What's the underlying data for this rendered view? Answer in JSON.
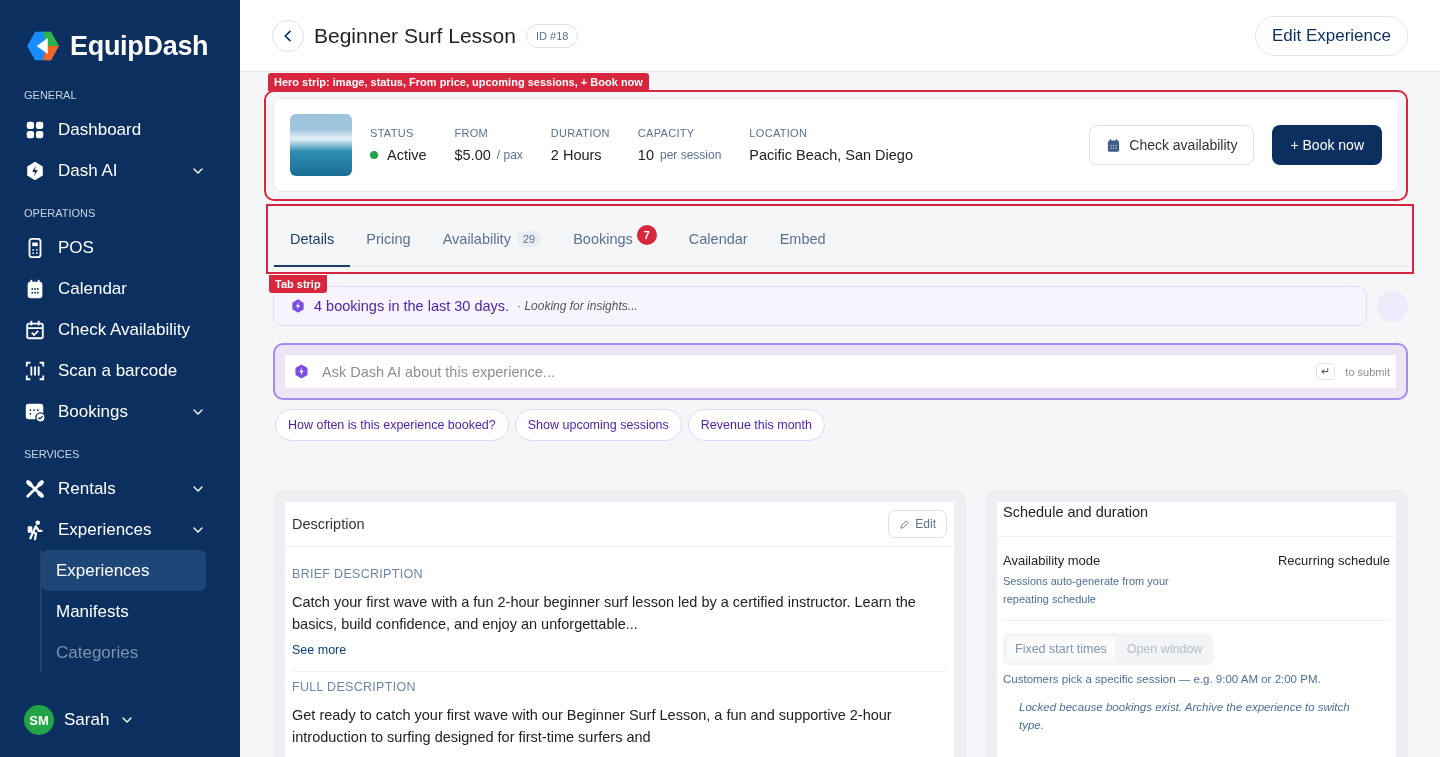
{
  "sidebar": {
    "brand": "EquipDash",
    "sections": [
      {
        "label": "GENERAL",
        "items": [
          {
            "kind": "link",
            "label": "Dashboard"
          },
          {
            "kind": "group",
            "label": "Dash AI"
          }
        ]
      },
      {
        "label": "OPERATIONS",
        "items": [
          {
            "kind": "link",
            "label": "POS"
          },
          {
            "kind": "link",
            "label": "Calendar"
          },
          {
            "kind": "link",
            "label": "Check Availability"
          },
          {
            "kind": "link",
            "label": "Scan a barcode"
          },
          {
            "kind": "group",
            "label": "Bookings"
          }
        ]
      },
      {
        "label": "SERVICES",
        "items": [
          {
            "kind": "group",
            "label": "Rentals"
          },
          {
            "kind": "group",
            "label": "Experiences",
            "children": [
              {
                "label": "Experiences",
                "selected": true
              },
              {
                "label": "Manifests",
                "selected": false
              },
              {
                "label": "Categories",
                "selected": false
              }
            ]
          }
        ]
      }
    ],
    "user": {
      "initials": "SM",
      "name": "Sarah"
    }
  },
  "header": {
    "title": "Beginner Surf Lesson",
    "id_badge": "ID #18",
    "edit_button": "Edit Experience"
  },
  "hero": {
    "annotation": "Hero strip: image, status, From price, upcoming sessions, + Book now",
    "fields": [
      {
        "kind": "status",
        "label": "STATUS",
        "value": "Active",
        "color": "#22a447"
      },
      {
        "kind": "unit",
        "label": "FROM",
        "value": "$5.00",
        "unit": "/ pax"
      },
      {
        "kind": "plain",
        "label": "DURATION",
        "value": "2 Hours"
      },
      {
        "kind": "unit",
        "label": "CAPACITY",
        "value": "10",
        "unit": "per session"
      },
      {
        "kind": "plain",
        "label": "LOCATION",
        "value": "Pacific Beach, San Diego"
      }
    ],
    "check_button": "Check availability",
    "book_button": "+ Book now"
  },
  "tabs": {
    "annotation": "Tab strip",
    "items": [
      {
        "label": "Details",
        "selected": true
      },
      {
        "label": "Pricing",
        "selected": false
      },
      {
        "label": "Availability",
        "selected": false,
        "count": "29"
      },
      {
        "label": "Bookings",
        "selected": false,
        "badge": "7"
      },
      {
        "label": "Calendar",
        "selected": false
      },
      {
        "label": "Embed",
        "selected": false
      }
    ]
  },
  "insight": {
    "text": "4 bookings in the last 30 days.",
    "status": "· Looking for insights..."
  },
  "ask": {
    "placeholder": "Ask Dash AI about this experience...",
    "submit_key": "↵",
    "submit_hint": "to submit",
    "suggestions": [
      "How often is this experience booked?",
      "Show upcoming sessions",
      "Revenue this month"
    ]
  },
  "description": {
    "title": "Description",
    "edit_button": "Edit",
    "brief_label": "BRIEF DESCRIPTION",
    "brief_text": "Catch your first wave with a fun 2-hour beginner surf lesson led by a certified instructor. Learn the basics, build confidence, and enjoy an unforgettable...",
    "see_more": "See more",
    "full_label": "FULL DESCRIPTION",
    "full_text": "Get ready to catch your first wave with our Beginner Surf Lesson, a fun and supportive 2-hour introduction to surfing designed for first-time surfers and"
  },
  "schedule": {
    "title": "Schedule and duration",
    "mode_label": "Availability mode",
    "mode_hint": "Sessions auto-generate from your repeating schedule",
    "mode_value": "Recurring schedule",
    "options": [
      {
        "label": "Fixed start times",
        "selected": true
      },
      {
        "label": "Open window",
        "selected": false
      }
    ],
    "help": "Customers pick a specific session — e.g. 9:00 AM or 2:00 PM.",
    "note": "Locked because bookings exist. Archive the experience to switch type."
  }
}
